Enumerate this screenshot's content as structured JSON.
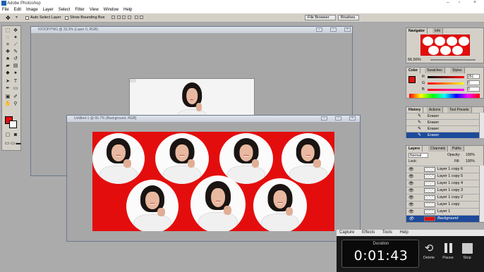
{
  "app": {
    "title": "Adobe Photoshop",
    "window_controls": [
      "–",
      "▫",
      "×"
    ]
  },
  "menu": [
    "File",
    "Edit",
    "Image",
    "Layer",
    "Select",
    "Filter",
    "View",
    "Window",
    "Help"
  ],
  "options_bar": {
    "auto_select_label": "Auto Select Layer",
    "show_bounding_label": "Show Bounding Box",
    "file_browser_label": "File Browser",
    "brushes_label": "Brushes"
  },
  "documents": {
    "back_title": "IOOOP.PNG @ 33.3% (Layer 0, RGB)",
    "front_title": "Untitled-1 @ 66.7% (Background, RGB)"
  },
  "navigator": {
    "tabs": [
      "Navigator",
      "Info"
    ],
    "zoom": "66.56%"
  },
  "color_panel": {
    "tabs": [
      "Color",
      "Swatches",
      "Styles"
    ],
    "r_label": "R",
    "r_value": "251",
    "g_label": "G",
    "g_value": "0",
    "b_label": "B",
    "b_value": "0",
    "accent": "#e01010"
  },
  "history_panel": {
    "tabs": [
      "History",
      "Actions",
      "Tool Presets"
    ],
    "items": [
      "Eraser",
      "Eraser",
      "Eraser",
      "Eraser"
    ]
  },
  "layers_panel": {
    "tabs": [
      "Layers",
      "Channels",
      "Paths"
    ],
    "blend_mode": "Normal",
    "opacity_label": "Opacity:",
    "opacity_value": "100%",
    "lock_label": "Lock:",
    "fill_label": "Fill:",
    "fill_value": "100%",
    "layers": [
      "Layer 1 copy 6",
      "Layer 1 copy 5",
      "Layer 1 copy 4",
      "Layer 1 copy 3",
      "Layer 1 copy 2",
      "Layer 1 copy",
      "Layer 1",
      "Background"
    ]
  },
  "recorder": {
    "menu": [
      "Capture",
      "Effects",
      "Tools",
      "Help"
    ],
    "duration_label": "Duration",
    "duration_value": "0:01:43",
    "buttons": [
      "Delete",
      "Pause",
      "Stop"
    ]
  }
}
